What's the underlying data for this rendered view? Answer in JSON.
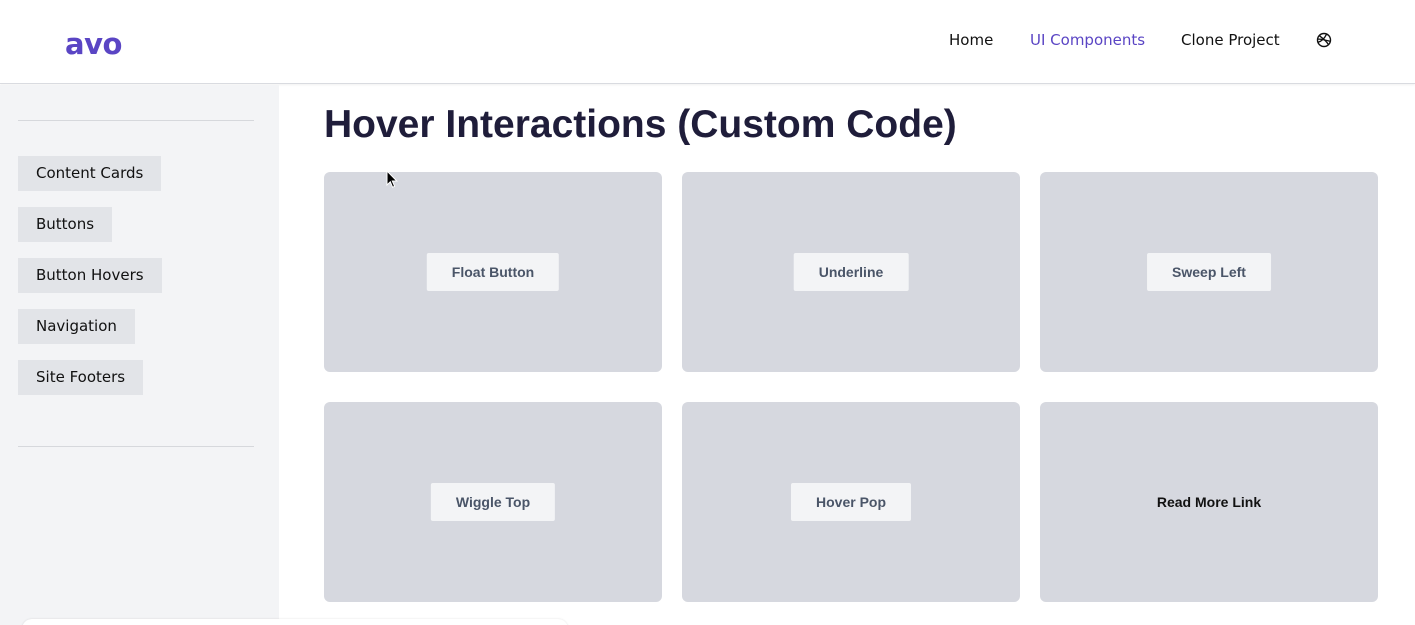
{
  "header": {
    "logo": "avo",
    "nav": [
      {
        "label": "Home",
        "active": false
      },
      {
        "label": "UI Components",
        "active": true
      },
      {
        "label": "Clone Project",
        "active": false
      }
    ],
    "nav_icon": "dribbble-icon"
  },
  "sidebar": {
    "items": [
      {
        "label": "Content Cards"
      },
      {
        "label": "Buttons"
      },
      {
        "label": "Button Hovers"
      },
      {
        "label": "Navigation"
      },
      {
        "label": "Site Footers"
      }
    ]
  },
  "main": {
    "title": "Hover Interactions (Custom Code)",
    "cards": [
      {
        "label": "Float Button",
        "kind": "button"
      },
      {
        "label": "Underline",
        "kind": "button"
      },
      {
        "label": "Sweep Left",
        "kind": "button"
      },
      {
        "label": "Wiggle Top",
        "kind": "button"
      },
      {
        "label": "Hover Pop",
        "kind": "button"
      },
      {
        "label": "Read More Link",
        "kind": "link"
      }
    ]
  },
  "colors": {
    "accent": "#5a45c4",
    "card_bg": "#d6d8df",
    "sidebar_bg": "#f3f4f6",
    "sidebar_item_bg": "#e2e4e8",
    "button_text": "#4a5568",
    "title_text": "#1f1d3a"
  }
}
